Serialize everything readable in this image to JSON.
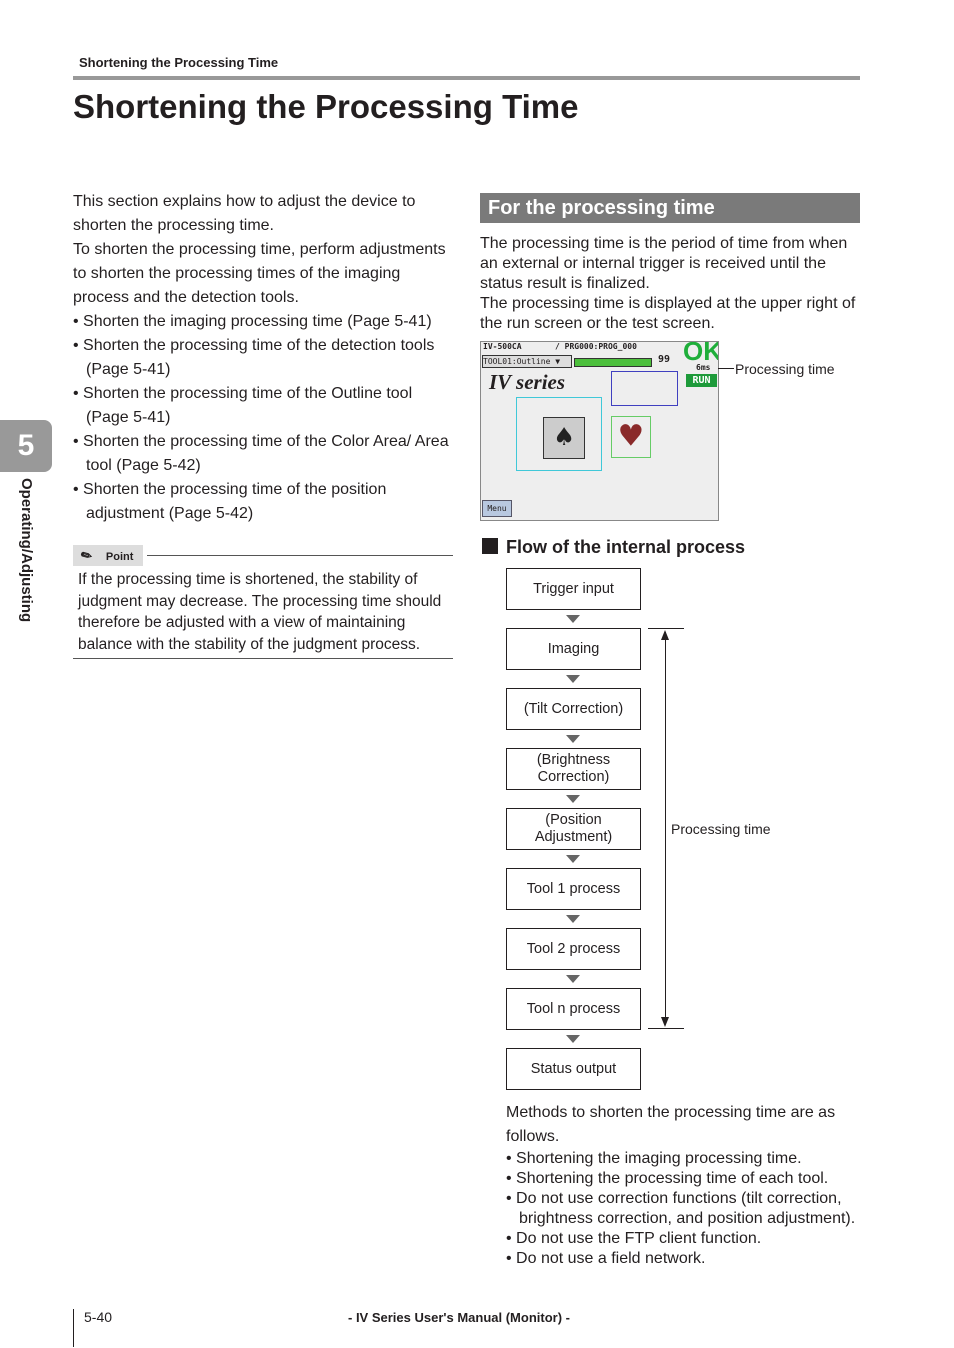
{
  "running_header": "Shortening the Processing Time",
  "title": "Shortening the Processing Time",
  "chapter": {
    "number": "5",
    "label": "Operating/Adjusting"
  },
  "intro": {
    "paragraphs": [
      "This section explains how to adjust the device to shorten the processing time.",
      "To shorten the processing time, perform adjustments to shorten the processing times of the imaging process and the detection tools."
    ],
    "bullets": [
      "Shorten the imaging processing time (Page 5-41)",
      "Shorten the processing time of the detection tools (Page 5-41)",
      "Shorten the processing time of the Outline tool (Page 5-41)",
      "Shorten the processing time of the Color Area/ Area tool (Page 5-42)",
      "Shorten the processing time of the position adjustment (Page 5-42)"
    ]
  },
  "point": {
    "label": "Point",
    "text": "If the processing time is shortened, the stability of judgment may decrease. The processing time should therefore be adjusted with a view of maintaining balance with the stability of the judgment process."
  },
  "section": {
    "heading": "For the processing time",
    "paragraphs": [
      "The processing time is the period of time from when an external or internal trigger is received until the status result is finalized.",
      "The processing time is displayed at the upper right of the run screen or the test screen."
    ]
  },
  "screen": {
    "model": "IV-500CA",
    "program": "PRG000:PROG_000",
    "tool": "TOOL01:Outline",
    "value": "99",
    "result": "OK",
    "time": "6ms",
    "mode": "RUN",
    "logo": "IV series",
    "menu": "Menu",
    "callout": "Processing time"
  },
  "flow": {
    "heading": "Flow of the internal process",
    "steps": [
      "Trigger input",
      "Imaging",
      "(Tilt Correction)",
      "(Brightness Correction)",
      "(Position Adjustment)",
      "Tool 1 process",
      "Tool 2 process",
      "Tool n process",
      "Status output"
    ],
    "span_label": "Processing time"
  },
  "methods": {
    "intro": "Methods to shorten the processing time are as follows.",
    "bullets": [
      "Shortening the imaging processing time.",
      "Shortening the processing time of each tool.",
      "Do not use correction functions (tilt correction, brightness correction, and position adjustment).",
      "Do not use the FTP client function.",
      "Do not use a field network."
    ]
  },
  "footer": {
    "page": "5-40",
    "manual": "- IV Series User's Manual (Monitor) -"
  }
}
